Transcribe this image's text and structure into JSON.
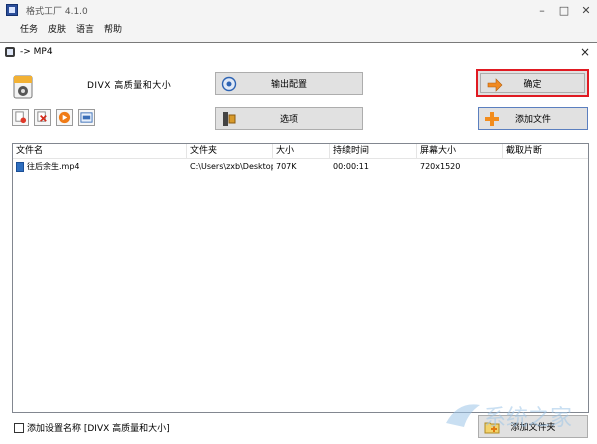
{
  "app": {
    "title": "格式工厂 4.1.0",
    "window_controls": {
      "minimize": "–",
      "maximize": "□",
      "close": "✕"
    },
    "menu": [
      "任务",
      "皮肤",
      "语言",
      "帮助"
    ]
  },
  "dialog": {
    "title": "-> MP4",
    "close": "×",
    "profile_name": "DIVX 高质量和大小",
    "output_config_label": "输出配置",
    "options_label": "选项",
    "confirm_label": "确定",
    "add_file_label": "添加文件",
    "add_folder_label": "添加文件夹",
    "add_setting_name_label": "添加设置名称 [DIVX 高质量和大小]",
    "add_setting_checked": false,
    "confirm_highlight_color": "#e01a22"
  },
  "tools": [
    {
      "name": "remove-item-icon"
    },
    {
      "name": "clear-list-icon"
    },
    {
      "name": "play-icon"
    },
    {
      "name": "media-info-icon"
    }
  ],
  "table": {
    "columns": [
      "文件名",
      "文件夹",
      "大小",
      "持续时间",
      "屏幕大小",
      "截取片断"
    ],
    "rows": [
      {
        "filename": "往后余生.mp4",
        "folder": "C:\\Users\\zxb\\Desktop",
        "size": "707K",
        "duration": "00:00:11",
        "resolution": "720x1520",
        "clip": ""
      }
    ]
  },
  "watermark": {
    "text": "系统之家"
  }
}
